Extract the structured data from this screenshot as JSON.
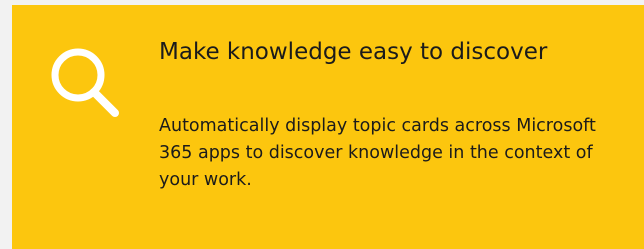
{
  "card": {
    "icon": "search-icon",
    "title": "Make knowledge easy to discover",
    "description": "Automatically display topic cards across Microsoft 365 apps to discover knowledge in the context of your work.",
    "colors": {
      "card_background": "#fcc60e",
      "page_background": "#f2f2f2",
      "icon": "#ffffff",
      "text": "#1b1b1b"
    }
  }
}
